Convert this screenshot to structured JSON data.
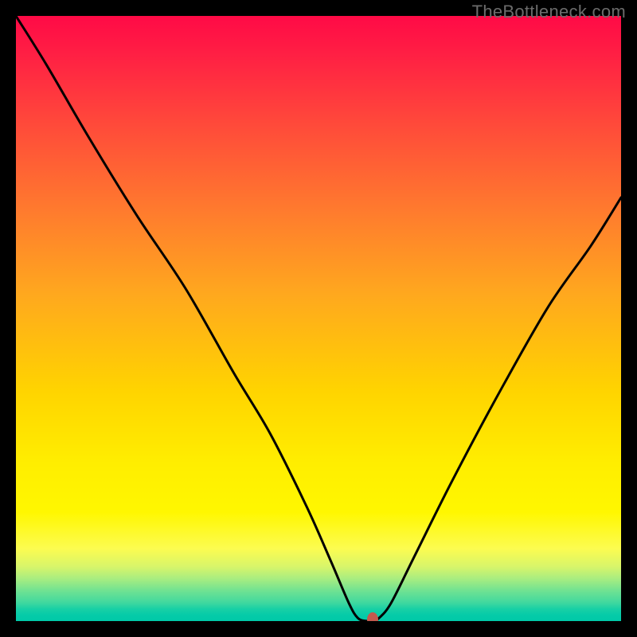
{
  "watermark": "TheBottleneck.com",
  "colors": {
    "page_bg": "#000000",
    "watermark_text": "#6b6b6b",
    "curve_stroke": "#000000",
    "marker_fill": "#c4594e",
    "gradient_top": "#ff0a46",
    "gradient_bottom": "#00c9a8"
  },
  "chart_data": {
    "type": "line",
    "title": "",
    "xlabel": "",
    "ylabel": "",
    "xlim": [
      0,
      100
    ],
    "ylim": [
      0,
      100
    ],
    "grid": false,
    "legend": false,
    "series": [
      {
        "name": "bottleneck-curve",
        "note": "x = normalized horizontal position (0–100), y = percent mismatch (0 at bottom/green, 100 at top/red); values estimated from pixels",
        "x": [
          0,
          5,
          12,
          20,
          28,
          36,
          42,
          48,
          52,
          55,
          56.5,
          58,
          59,
          60,
          62,
          66,
          72,
          80,
          88,
          95,
          100
        ],
        "y": [
          100,
          92,
          80,
          67,
          55,
          41,
          31,
          19,
          10,
          3,
          0.5,
          0,
          0,
          0.5,
          3,
          11,
          23,
          38,
          52,
          62,
          70
        ]
      }
    ],
    "marker": {
      "x": 59,
      "y": 0.2
    },
    "background_gradient": {
      "orientation": "vertical",
      "stops": [
        {
          "pos": 0.0,
          "color": "#ff0a46"
        },
        {
          "pos": 0.06,
          "color": "#ff1e44"
        },
        {
          "pos": 0.18,
          "color": "#ff4a3a"
        },
        {
          "pos": 0.32,
          "color": "#ff7a2e"
        },
        {
          "pos": 0.46,
          "color": "#ffa81e"
        },
        {
          "pos": 0.62,
          "color": "#ffd400"
        },
        {
          "pos": 0.74,
          "color": "#ffee00"
        },
        {
          "pos": 0.82,
          "color": "#fff700"
        },
        {
          "pos": 0.88,
          "color": "#fcfc50"
        },
        {
          "pos": 0.91,
          "color": "#d8f56a"
        },
        {
          "pos": 0.93,
          "color": "#a8ed80"
        },
        {
          "pos": 0.95,
          "color": "#6fe292"
        },
        {
          "pos": 0.97,
          "color": "#3fd89f"
        },
        {
          "pos": 0.98,
          "color": "#18d0a5"
        },
        {
          "pos": 0.99,
          "color": "#06cba8"
        },
        {
          "pos": 1.0,
          "color": "#00c9a8"
        }
      ]
    }
  }
}
